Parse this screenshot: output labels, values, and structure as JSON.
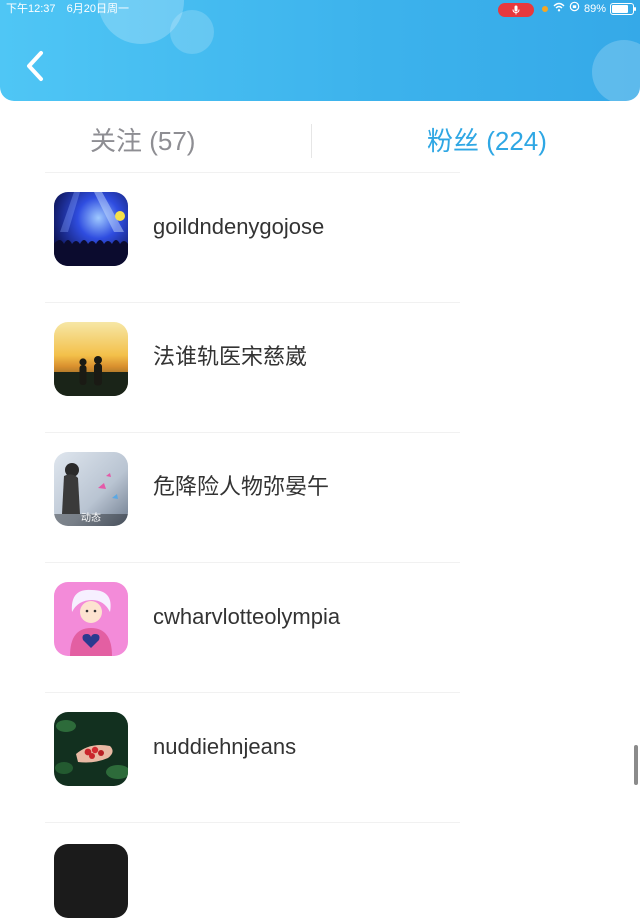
{
  "status_bar": {
    "time": "下午12:37",
    "date": "6月20日周一",
    "battery": "89%",
    "battery_level": 0.89,
    "mic_indicator_color": "#e8383d",
    "icons": [
      "mic-icon",
      "wifi-icon",
      "lock-rotation-icon",
      "battery-icon"
    ]
  },
  "header": {
    "back_icon": "chevron-left-icon",
    "gradient_start": "#4fc6f5",
    "gradient_end": "#35a9e8"
  },
  "tabs": [
    {
      "label": "关注 (57)",
      "active": false
    },
    {
      "label": "粉丝 (224)",
      "active": true
    }
  ],
  "accent_color": "#2fa7e4",
  "fans": [
    {
      "username": "goildndenygojose",
      "avatar": "concert-crowd-image"
    },
    {
      "username": "法谁轨医宋慈崴",
      "avatar": "sunset-couple-image"
    },
    {
      "username": "危降险人物弥晏午",
      "avatar": "girl-butterflies-image",
      "avatar_badge": "动态"
    },
    {
      "username": "cwharvlotteolympia",
      "avatar": "cartoon-girl-heart-image"
    },
    {
      "username": "nuddiehnjeans",
      "avatar": "strawberries-hands-image"
    }
  ]
}
